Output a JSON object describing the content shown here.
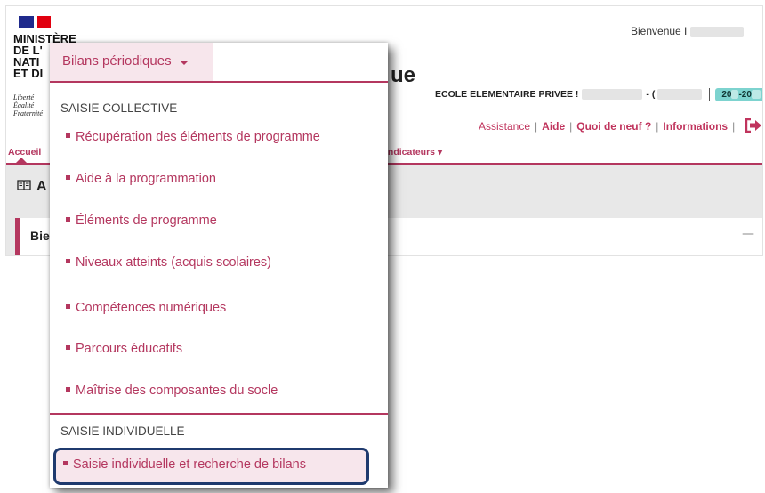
{
  "header": {
    "ministry": [
      "MINISTÈRE",
      "DE L'",
      "NATI",
      "ET DI"
    ],
    "motto": [
      "Liberté",
      "Égalité",
      "Fraternité"
    ],
    "app_title_fragment": "ue",
    "welcome": "Bienvenue I",
    "school_prefix": "ECOLE ELEMENTAIRE PRIVEE !",
    "school_mid": "- (",
    "year_a": "20",
    "year_b": "-20",
    "links": [
      "Assistance",
      "Aide",
      "Quoi de neuf ?",
      "Informations"
    ]
  },
  "nav": {
    "home": "Accueil",
    "indicators": "Indicateurs ▾"
  },
  "main": {
    "section_title": "A",
    "card_title": "Bie",
    "collapse": "—"
  },
  "dropdown": {
    "trigger": "Bilans périodiques",
    "section_collective": "SAISIE COLLECTIVE",
    "items": [
      "Récupération des éléments de programme",
      "Aide à la programmation",
      "Éléments de programme",
      "Niveaux atteints (acquis scolaires)",
      "Compétences numériques",
      "Parcours éducatifs",
      "Maîtrise des composantes du socle"
    ],
    "section_individual": "SAISIE INDIVIDUELLE",
    "highlighted_item": "Saisie individuelle et recherche de bilans"
  },
  "colors": {
    "accent": "#b4375f",
    "highlight_border": "#1f3a6e",
    "badge": "#7dd3cf"
  },
  "icons": {
    "exit": "exit-icon",
    "book": "book-icon"
  }
}
